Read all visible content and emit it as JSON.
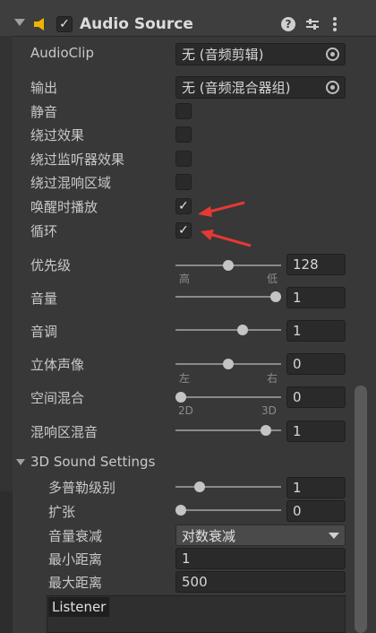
{
  "component": {
    "title": "Audio Source"
  },
  "fields": {
    "audioclip_label": "AudioClip",
    "audioclip_value": "无 (音频剪辑)",
    "output_label": "输出",
    "output_value": "无 (音频混合器组)",
    "mute_label": "静音",
    "bypass_effects_label": "绕过效果",
    "bypass_listener_effects_label": "绕过监听器效果",
    "bypass_reverb_zones_label": "绕过混响区域",
    "play_on_awake_label": "唤醒时播放",
    "loop_label": "循环"
  },
  "checkboxes": {
    "mute": false,
    "bypass_effects": false,
    "bypass_listener_effects": false,
    "bypass_reverb_zones": false,
    "play_on_awake": true,
    "loop": true
  },
  "sliders": {
    "priority": {
      "label": "优先级",
      "value": "128",
      "fraction": 0.5,
      "min_label": "高",
      "max_label": "低"
    },
    "volume": {
      "label": "音量",
      "value": "1",
      "fraction": 1.0
    },
    "pitch": {
      "label": "音调",
      "value": "1",
      "fraction": 0.65
    },
    "stereo_pan": {
      "label": "立体声像",
      "value": "0",
      "fraction": 0.5,
      "min_label": "左",
      "max_label": "右"
    },
    "spatial_blend": {
      "label": "空间混合",
      "value": "0",
      "fraction": 0.0,
      "min_label": "2D",
      "max_label": "3D"
    },
    "reverb_zone_mix": {
      "label": "混响区混音",
      "value": "1",
      "fraction": 0.9
    },
    "doppler_level": {
      "label": "多普勒级别",
      "value": "1",
      "fraction": 0.2
    },
    "spread": {
      "label": "扩张",
      "value": "0",
      "fraction": 0.0
    }
  },
  "sound3d": {
    "section_label": "3D Sound Settings",
    "rolloff_label": "音量衰减",
    "rolloff_value": "对数衰减",
    "min_distance_label": "最小距离",
    "min_distance_value": "1",
    "max_distance_label": "最大距离",
    "max_distance_value": "500",
    "listener_label": "Listener"
  },
  "colors": {
    "annotation_arrow": "#e53935"
  }
}
